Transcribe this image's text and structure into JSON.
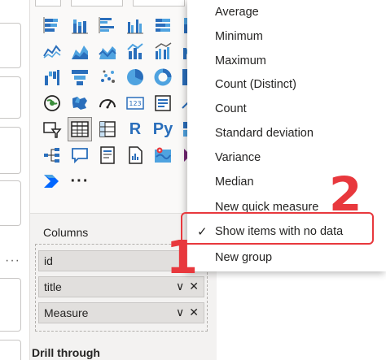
{
  "visualizations": {
    "icons": [
      "stacked-bar-icon",
      "stacked-column-icon",
      "clustered-bar-icon",
      "clustered-column-icon",
      "100-stacked-bar-icon",
      "100-stacked-column-icon",
      "line-chart-icon",
      "area-chart-icon",
      "stacked-area-icon",
      "line-column-icon",
      "line-clustered-column-icon",
      "ribbon-chart-icon",
      "waterfall-icon",
      "funnel-icon",
      "scatter-icon",
      "pie-chart-icon",
      "donut-chart-icon",
      "treemap-icon",
      "map-icon",
      "filled-map-icon",
      "gauge-icon",
      "card-icon",
      "multi-row-card-icon",
      "kpi-icon",
      "slicer-icon",
      "table-icon",
      "matrix-icon",
      "r-visual-icon",
      "python-visual-icon",
      "key-influencers-icon",
      "decomposition-tree-icon",
      "qa-icon",
      "smart-narrative-icon",
      "paginated-report-icon",
      "azure-map-icon",
      "power-apps-icon",
      "power-automate-icon",
      "more-visuals-icon"
    ],
    "r_label": "R",
    "py_label": "Py",
    "more_label": "···"
  },
  "columns": {
    "label": "Columns",
    "fields": [
      {
        "name": "id"
      },
      {
        "name": "title"
      },
      {
        "name": "Measure"
      }
    ],
    "chevron": "∨",
    "remove": "✕"
  },
  "drill_through": {
    "label": "Drill through"
  },
  "left_dots": "···",
  "context_menu": {
    "items": [
      {
        "label": "Average"
      },
      {
        "label": "Minimum"
      },
      {
        "label": "Maximum"
      },
      {
        "label": "Count (Distinct)"
      },
      {
        "label": "Count"
      },
      {
        "label": "Standard deviation"
      },
      {
        "label": "Variance"
      },
      {
        "label": "Median"
      },
      {
        "label": "New quick measure"
      },
      {
        "label": "Show items with no data",
        "checked": true
      },
      {
        "label": "New group"
      }
    ],
    "check_mark": "✓"
  },
  "annotations": {
    "one": "1",
    "two": "2",
    "color": "#e8383d"
  }
}
